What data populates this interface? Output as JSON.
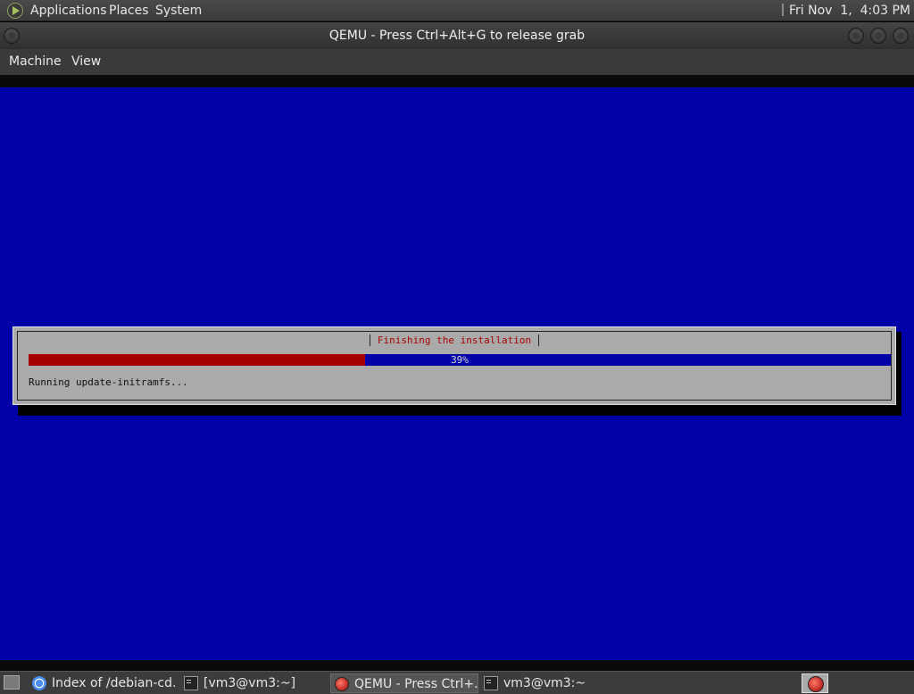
{
  "top_panel": {
    "menus": [
      "Applications",
      "Places",
      "System"
    ],
    "clock": "Fri Nov  1,  4:03 PM"
  },
  "window": {
    "title": "QEMU - Press Ctrl+Alt+G to release grab",
    "menus": [
      "Machine",
      "View"
    ]
  },
  "installer": {
    "dialog_title": "Finishing the installation",
    "progress_percent": 39,
    "progress_label": "39%",
    "status": "Running update-initramfs...",
    "colors": {
      "background": "#0000a8",
      "dialog": "#aaaaaa",
      "progress_fill": "#a80000",
      "progress_track": "#0000a8",
      "title_text": "#a80000"
    }
  },
  "taskbar": {
    "tasks": [
      {
        "label": "Index of /debian-cd...",
        "icon": "chrome-icon"
      },
      {
        "label": "[vm3@vm3:~]",
        "icon": "terminal-icon"
      },
      {
        "label": "QEMU - Press Ctrl+...",
        "icon": "qemu-icon",
        "active": true
      },
      {
        "label": "vm3@vm3:~",
        "icon": "terminal-icon"
      }
    ]
  }
}
